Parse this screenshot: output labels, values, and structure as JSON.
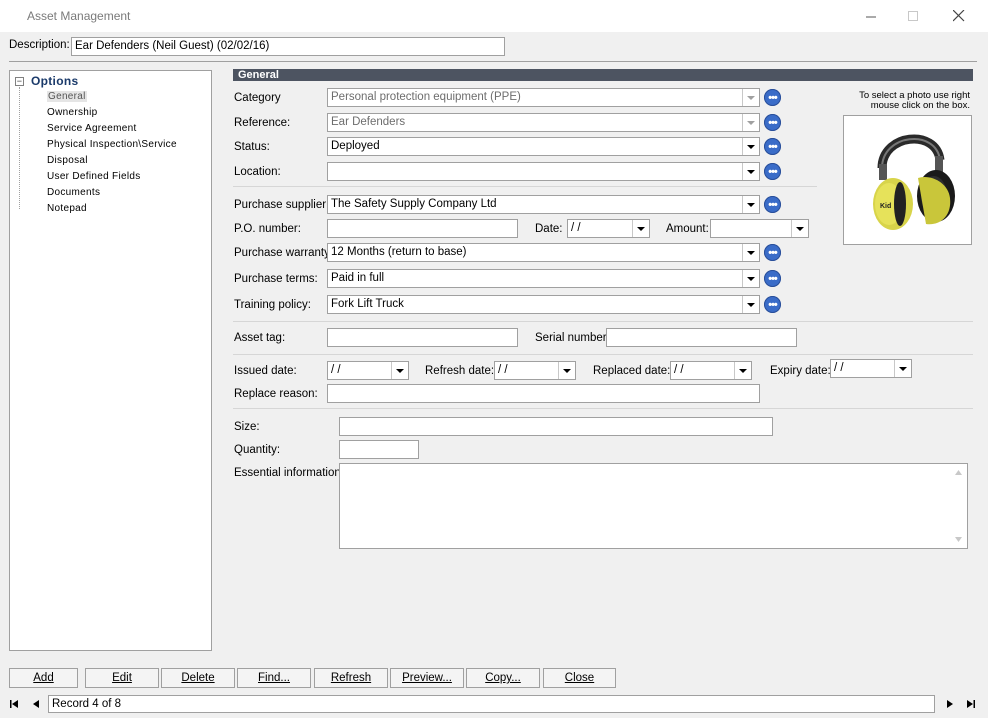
{
  "window": {
    "title": "Asset Management"
  },
  "description": {
    "label": "Description:",
    "value": "Ear Defenders (Neil Guest) (02/02/16)"
  },
  "tree": {
    "root": "Options",
    "items": [
      "General",
      "Ownership",
      "Service Agreement",
      "Physical Inspection\\Service",
      "Disposal",
      "User Defined Fields",
      "Documents",
      "Notepad"
    ]
  },
  "section": {
    "title": "General"
  },
  "photo_hint": {
    "line1": "To select a photo use right",
    "line2": "mouse click on the box."
  },
  "fields": {
    "category": {
      "label": "Category",
      "value": "Personal protection equipment (PPE)"
    },
    "reference": {
      "label": "Reference:",
      "value": "Ear Defenders"
    },
    "status": {
      "label": "Status:",
      "value": "Deployed"
    },
    "location": {
      "label": "Location:",
      "value": ""
    },
    "purchase_supplier": {
      "label": "Purchase supplier:",
      "value": "The Safety Supply Company Ltd"
    },
    "po_number": {
      "label": "P.O. number:",
      "value": ""
    },
    "date": {
      "label": "Date:",
      "value": " /  /"
    },
    "amount": {
      "label": "Amount:",
      "value": ""
    },
    "purchase_warranty": {
      "label": "Purchase warranty:",
      "value": "12 Months (return to base)"
    },
    "purchase_terms": {
      "label": "Purchase terms:",
      "value": "Paid in full"
    },
    "training_policy": {
      "label": "Training policy:",
      "value": "Fork Lift Truck"
    },
    "asset_tag": {
      "label": "Asset tag:",
      "value": ""
    },
    "serial_number": {
      "label": "Serial number:",
      "value": ""
    },
    "issued_date": {
      "label": "Issued date:",
      "value": " /  /"
    },
    "refresh_date": {
      "label": "Refresh date:",
      "value": " /  /"
    },
    "replaced_date": {
      "label": "Replaced date:",
      "value": " /  /"
    },
    "expiry_date": {
      "label": "Expiry date:",
      "value": " /  /"
    },
    "replace_reason": {
      "label": "Replace reason:",
      "value": ""
    },
    "size": {
      "label": "Size:",
      "value": ""
    },
    "quantity": {
      "label": "Quantity:",
      "value": ""
    },
    "essential_info": {
      "label": "Essential information:",
      "value": ""
    }
  },
  "buttons": {
    "add": "Add",
    "edit": "Edit",
    "delete": "Delete",
    "find": "Find...",
    "refresh": "Refresh",
    "preview": "Preview...",
    "copy": "Copy...",
    "close": "Close"
  },
  "record": {
    "text": "Record 4 of 8"
  },
  "colors": {
    "header": "#4d5461",
    "ellipsis_button": "#3a6cc8"
  }
}
